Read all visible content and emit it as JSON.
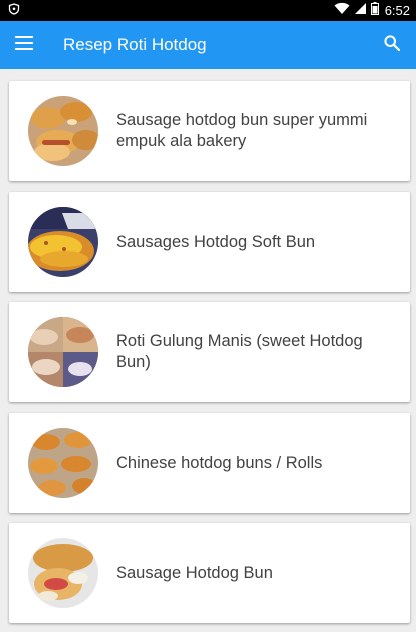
{
  "status_bar": {
    "time": "6:52"
  },
  "app_bar": {
    "title": "Resep Roti Hotdog"
  },
  "recipes": [
    {
      "title": "Sausage hotdog bun super yummi empuk ala bakery"
    },
    {
      "title": "Sausages Hotdog Soft Bun"
    },
    {
      "title": "Roti Gulung Manis (sweet Hotdog Bun)"
    },
    {
      "title": "Chinese hotdog buns / Rolls"
    },
    {
      "title": "Sausage Hotdog Bun"
    }
  ],
  "colors": {
    "app_bar": "#2196f3",
    "status_bar": "#000000",
    "background": "#eeeeee"
  }
}
